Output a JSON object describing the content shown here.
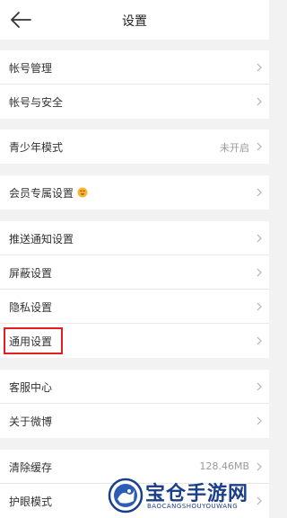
{
  "header": {
    "title": "设置"
  },
  "groups": [
    {
      "items": [
        {
          "label": "帐号管理"
        },
        {
          "label": "帐号与安全"
        }
      ]
    },
    {
      "items": [
        {
          "label": "青少年模式",
          "value": "未开启"
        }
      ]
    },
    {
      "items": [
        {
          "label": "会员专属设置"
        }
      ]
    },
    {
      "items": [
        {
          "label": "推送通知设置"
        },
        {
          "label": "屏蔽设置"
        },
        {
          "label": "隐私设置"
        },
        {
          "label": "通用设置"
        }
      ]
    },
    {
      "items": [
        {
          "label": "客服中心"
        },
        {
          "label": "关于微博"
        }
      ]
    },
    {
      "items": [
        {
          "label": "清除缓存",
          "value": "128.46MB"
        },
        {
          "label": "护眼模式"
        }
      ]
    }
  ],
  "watermark": {
    "title": "宝仓手游网",
    "subtitle": "BAOCANGSHOUYOUWANG"
  },
  "colors": {
    "highlight": "#e02020",
    "watermark": "#1c3f8a"
  }
}
